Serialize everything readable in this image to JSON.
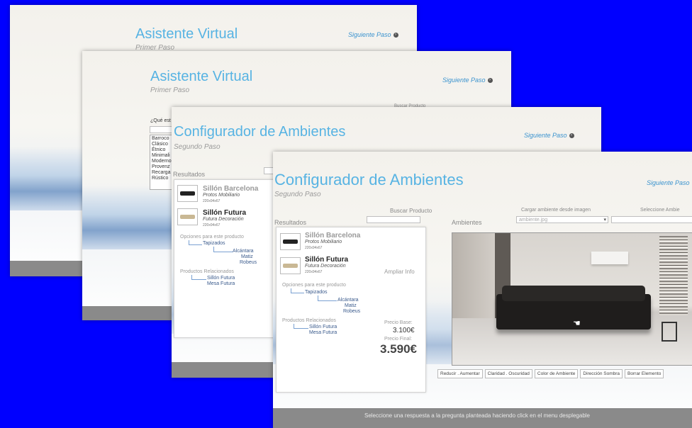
{
  "win1": {
    "title": "Asistente Virtual",
    "subtitle": "Primer Paso",
    "next": "Siguiente Paso"
  },
  "win2": {
    "title": "Asistente Virtual",
    "subtitle": "Primer Paso",
    "next": "Siguiente Paso",
    "question": "¿Qué est",
    "right_label": "Buscar Producto",
    "styles": [
      "Barroco",
      "Clásico",
      "Étnico",
      "Minimali",
      "Moderno",
      "Provenz",
      "Recarga",
      "Rústico"
    ]
  },
  "win3": {
    "title": "Configurador de Ambientes",
    "subtitle": "Segundo Paso",
    "next": "Siguiente Paso",
    "results_label": "Resultados",
    "products": [
      {
        "name": "Sillón Barcelona",
        "brand": "Protos Mobiliario",
        "code": "220x94x67"
      },
      {
        "name": "Sillón Futura",
        "brand": "Futura Decoración",
        "code": "220x94x67"
      }
    ],
    "options_head": "Opciones para este producto",
    "option": "Tapizados",
    "materials": [
      "Alcántara",
      "Matiz",
      "Robeus"
    ],
    "related_head": "Productos Relacionados",
    "related": [
      "Sillón Futura",
      "Mesa Futura"
    ]
  },
  "win4": {
    "title": "Configurador de Ambientes",
    "subtitle": "Segundo Paso",
    "next": "Siguiente Paso",
    "search_label": "Buscar Producto",
    "results_label": "Resultados",
    "ambientes_label": "Ambientes",
    "load_label": "Cargar ambiente desde imagen",
    "load_value": "ambiente.jpg",
    "select_label": "Seleccione Ambie",
    "products": [
      {
        "name": "Sillón Barcelona",
        "brand": "Protos Mobiliario",
        "code": "220x94x67"
      },
      {
        "name": "Sillón Futura",
        "brand": "Futura Decoración",
        "code": "220x94x67"
      }
    ],
    "more_info": "Ampliar Info",
    "options_head": "Opciones para este producto",
    "option": "Tapizados",
    "materials": [
      "Alcántara",
      "Matiz",
      "Robeus"
    ],
    "related_head": "Productos Relacionados",
    "related": [
      "Sillón Futura",
      "Mesa Futura"
    ],
    "base_price_label": "Precio Base:",
    "base_price": "3.100€",
    "final_price_label": "Precio Final:",
    "final_price": "3.590€",
    "buttons": [
      "Reducir . Aumentar",
      "Claridad . Oscuridad",
      "Color de Ambiente",
      "Dirección Sombra",
      "Borrar Elemento"
    ],
    "footer": "Seleccione una respuesta a la pregunta planteada haciendo click en el menu desplegable"
  },
  "colors": {
    "background": "#0000ff",
    "title": "#57b3e3",
    "link": "#3b93cf",
    "footer": "#8a8a8a"
  },
  "icons": {
    "next": "circle-arrow-icon",
    "dropdown": "chevron-down-icon",
    "cursor": "hand-cursor-icon"
  }
}
